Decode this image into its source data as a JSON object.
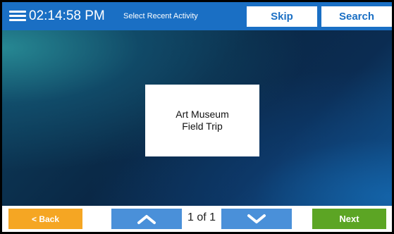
{
  "header": {
    "clock": "02:14:58 PM",
    "subtitle": "Select Recent Activity",
    "skip_label": "Skip",
    "search_label": "Search"
  },
  "main": {
    "activities": [
      {
        "line1": "Art Museum",
        "line2": "Field Trip"
      }
    ]
  },
  "footer": {
    "back_label": "< Back",
    "page_indicator": "1 of 1",
    "next_label": "Next"
  },
  "colors": {
    "header_bg": "#1a6fc4",
    "back_button": "#f5a623",
    "arrow_buttons": "#4a90d9",
    "next_button": "#5ca524"
  },
  "icons": {
    "menu": "hamburger-menu-icon",
    "up": "chevron-up-icon",
    "down": "chevron-down-icon"
  }
}
